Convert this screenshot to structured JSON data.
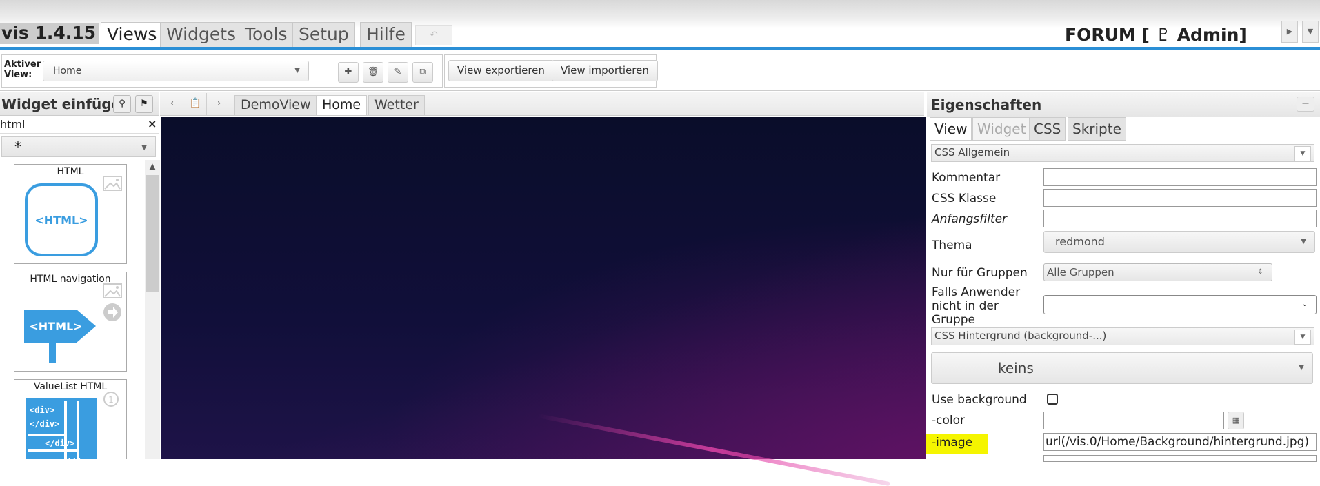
{
  "app": {
    "title": "vis 1.4.15"
  },
  "top_tabs": [
    {
      "label": "Views"
    },
    {
      "label": "Widgets"
    },
    {
      "label": "Tools"
    },
    {
      "label": "Setup"
    },
    {
      "label": "Hilfe"
    }
  ],
  "header": {
    "undo_icon": "undo-icon",
    "project": "FORUM [ ♇ Admin]"
  },
  "toolbar": {
    "active_view_label": "Aktiver View:",
    "active_view_value": "Home",
    "export_label": "View exportieren",
    "import_label": "View importieren"
  },
  "left": {
    "title": "Widget einfügen",
    "filter_value": "html",
    "filter_clear": "×",
    "set_value": "*",
    "widgets": [
      {
        "title": "HTML",
        "icon_text": "<HTML>"
      },
      {
        "title": "HTML navigation",
        "icon_text": "<HTML>"
      },
      {
        "title": "ValueList HTML",
        "icon_text": "<div></div>",
        "badge": "1",
        "code_lines": [
          "<div>",
          "</div>",
          "</div>",
          "..."
        ]
      }
    ]
  },
  "center": {
    "view_tabs": [
      {
        "label": "DemoView"
      },
      {
        "label": "Home"
      },
      {
        "label": "Wetter"
      }
    ]
  },
  "right": {
    "title": "Eigenschaften",
    "tabs": [
      {
        "label": "View"
      },
      {
        "label": "Widget"
      },
      {
        "label": "CSS"
      },
      {
        "label": "Skripte"
      }
    ],
    "groups": {
      "css_general": "CSS Allgemein",
      "css_background": "CSS Hintergrund (background-...)"
    },
    "fields": {
      "kommentar": "Kommentar",
      "css_klasse": "CSS Klasse",
      "anfangsfilter": "Anfangsfilter",
      "thema": "Thema",
      "thema_value": "redmond",
      "nur_gruppen": "Nur für Gruppen",
      "nur_gruppen_value": "Alle Gruppen",
      "falls_anwender": "Falls Anwender nicht in der Gruppe",
      "background_value": "keins",
      "use_background": "Use background",
      "color": "-color",
      "image": "-image",
      "image_value": "url(/vis.0/Home/Background/hintergrund.jpg)"
    },
    "highlight_color": "#f5f500"
  },
  "colors": {
    "accent": "#2b8fd6",
    "canvas": "#0d0f30",
    "widget_blue": "#3a9de0"
  }
}
